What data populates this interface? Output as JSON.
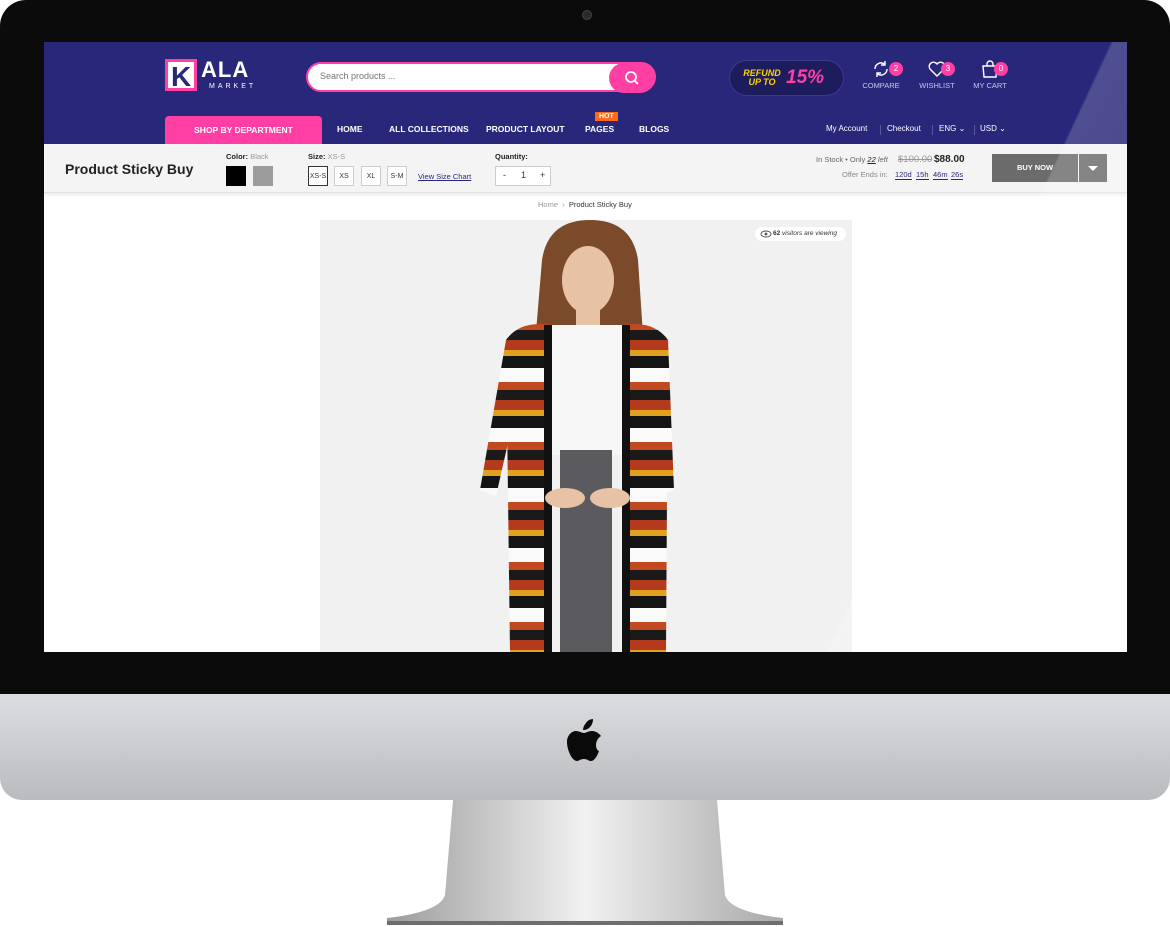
{
  "brand": {
    "logo_letter": "K",
    "logo_word": "ALA",
    "logo_sub": "MARKET"
  },
  "search": {
    "placeholder": "Search products ..."
  },
  "promo": {
    "line1": "REFUND",
    "line2": "UP TO",
    "percent": "15%"
  },
  "header_icons": {
    "compare": {
      "label": "COMPARE",
      "count": "2"
    },
    "wishlist": {
      "label": "WISHLIST",
      "count": "3"
    },
    "cart": {
      "label": "MY CART",
      "count": "0"
    }
  },
  "nav": {
    "department": "SHOP BY DEPARTMENT",
    "items": [
      "HOME",
      "ALL COLLECTIONS",
      "PRODUCT LAYOUT",
      "PAGES",
      "BLOGS"
    ],
    "hot_badge": "HOT",
    "my_account": "My Account",
    "checkout": "Checkout",
    "language": "ENG",
    "currency": "USD"
  },
  "sticky": {
    "title": "Product Sticky Buy",
    "color_label": "Color:",
    "color_value": "Black",
    "size_label": "Size:",
    "size_value": "XS-S",
    "sizes": [
      "XS-S",
      "XS",
      "XL",
      "S-M"
    ],
    "size_chart": "View Size Chart",
    "quantity_label": "Quantity:",
    "quantity": "1",
    "minus": "-",
    "plus": "+",
    "stock_text": "In Stock • Only",
    "stock_count": "22",
    "stock_suffix": "left",
    "old_price": "$100.00",
    "new_price": "$88.00",
    "offer_label": "Offer Ends in:",
    "timer": [
      "120d",
      "15h",
      "46m",
      "26s"
    ],
    "buy_now": "BUY NOW"
  },
  "breadcrumb": {
    "home": "Home",
    "current": "Product Sticky Buy"
  },
  "visitors": {
    "count": "62",
    "text": "visitors are viewing"
  },
  "colors": {
    "header": "#28277a",
    "accent": "#ff3fa4",
    "hot": "#ff6a1a"
  }
}
